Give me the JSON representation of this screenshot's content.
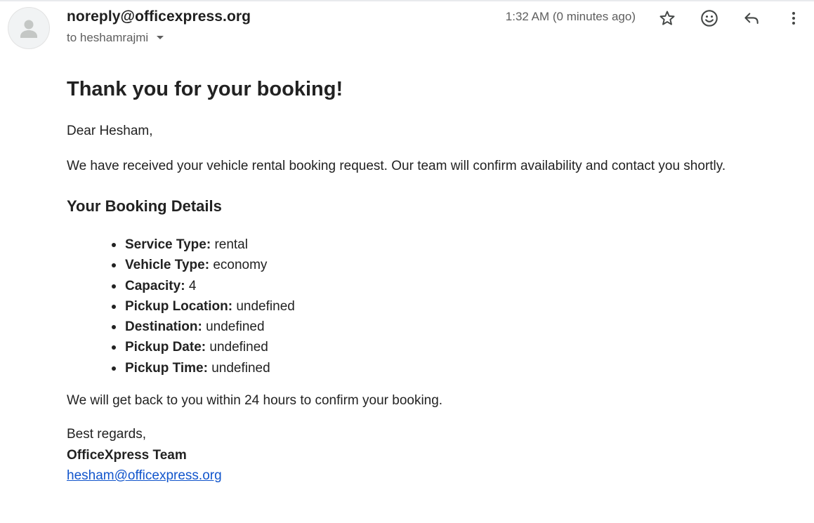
{
  "header": {
    "sender": "noreply@officexpress.org",
    "recipient": "to heshamrajmi",
    "timestamp": "1:32 AM (0 minutes ago)",
    "actions": [
      {
        "name": "star",
        "icon": "star-icon"
      },
      {
        "name": "react",
        "icon": "emoji-icon"
      },
      {
        "name": "reply",
        "icon": "reply-icon"
      },
      {
        "name": "more",
        "icon": "more-vert-icon"
      }
    ]
  },
  "body": {
    "title": "Thank you for your booking!",
    "greeting": "Dear Hesham,",
    "intro": "We have received your vehicle rental booking request. Our team will confirm availability and contact you shortly.",
    "details_heading": "Your Booking Details",
    "details": [
      {
        "label": "Service Type:",
        "value": "rental"
      },
      {
        "label": "Vehicle Type:",
        "value": "economy"
      },
      {
        "label": "Capacity:",
        "value": "4"
      },
      {
        "label": "Pickup Location:",
        "value": "undefined"
      },
      {
        "label": "Destination:",
        "value": "undefined"
      },
      {
        "label": "Pickup Date:",
        "value": "undefined"
      },
      {
        "label": "Pickup Time:",
        "value": "undefined"
      }
    ],
    "followup": "We will get back to you within 24 hours to confirm your booking.",
    "signoff": "Best regards,",
    "team": "OfficeXpress Team",
    "contact_email": "hesham@officexpress.org"
  },
  "colors": {
    "text": "#222222",
    "muted": "#5e5e5e",
    "link": "#1155cc",
    "avatar_bg": "#f1f3f4",
    "avatar_glyph": "#c4c7c5"
  }
}
